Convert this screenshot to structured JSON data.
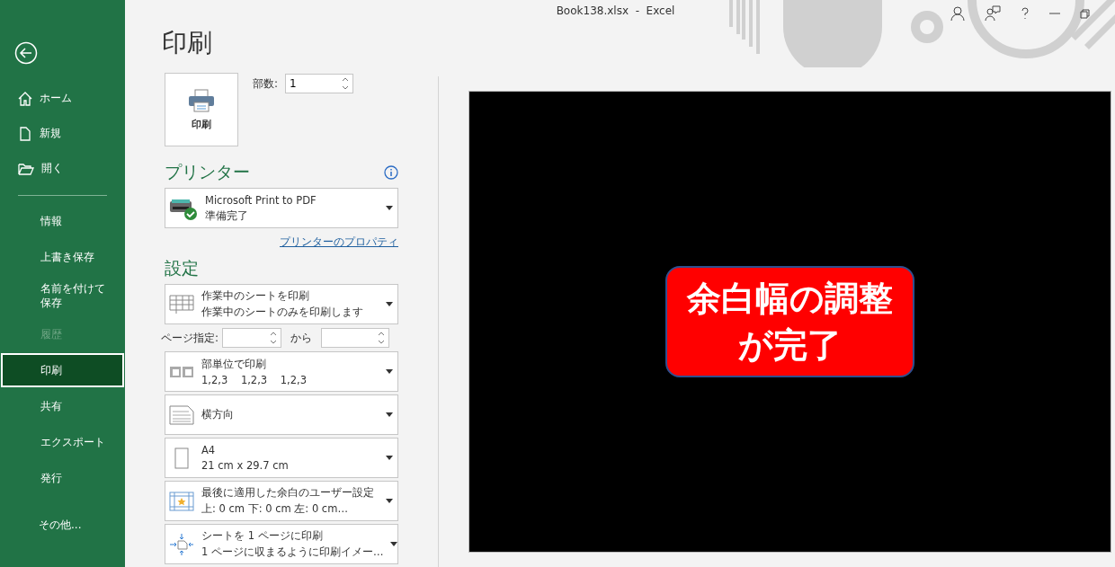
{
  "window": {
    "title": "Book138.xlsx  -  Excel"
  },
  "sidebar": {
    "top_items": [
      {
        "kind": "home",
        "label": "ホーム"
      },
      {
        "kind": "new",
        "label": "新規"
      },
      {
        "kind": "open",
        "label": "開く"
      }
    ],
    "items": [
      {
        "label": "情報",
        "selected": false,
        "disabled": false
      },
      {
        "label": "上書き保存",
        "selected": false,
        "disabled": false
      },
      {
        "label": "名前を付けて保存",
        "selected": false,
        "disabled": false
      },
      {
        "label": "履歴",
        "selected": false,
        "disabled": true
      },
      {
        "label": "印刷",
        "selected": true,
        "disabled": false
      },
      {
        "label": "共有",
        "selected": false,
        "disabled": false
      },
      {
        "label": "エクスポート",
        "selected": false,
        "disabled": false
      },
      {
        "label": "発行",
        "selected": false,
        "disabled": false
      }
    ],
    "more": "その他..."
  },
  "print": {
    "heading": "印刷",
    "button_label": "印刷",
    "copies_label": "部数:",
    "copies_value": "1"
  },
  "printer": {
    "heading": "プリンター",
    "name": "Microsoft Print to PDF",
    "status": "準備完了",
    "properties_link": "プリンターのプロパティ"
  },
  "settings": {
    "heading": "設定",
    "scope": {
      "kind": "sheets",
      "line1": "作業中のシートを印刷",
      "line2": "作業中のシートのみを印刷します"
    },
    "page_range": {
      "label": "ページ指定:",
      "to_label": "から"
    },
    "options": [
      {
        "kind": "collate",
        "line1": "部単位で印刷",
        "line2": "1,2,3    1,2,3    1,2,3"
      },
      {
        "kind": "orientation",
        "line1": "横方向"
      },
      {
        "kind": "paper",
        "line1": "A4",
        "line2": "21 cm x 29.7 cm"
      },
      {
        "kind": "margins",
        "line1": "最後に適用した余白のユーザー設定",
        "line2": "上: 0 cm 下: 0 cm 左: 0 cm…"
      },
      {
        "kind": "scaling",
        "line1": "シートを 1 ページに印刷",
        "line2": "1 ページに収まるように印刷イメー…"
      }
    ]
  },
  "preview": {
    "callout_lines": [
      "余白幅の調整",
      "が完了"
    ]
  }
}
